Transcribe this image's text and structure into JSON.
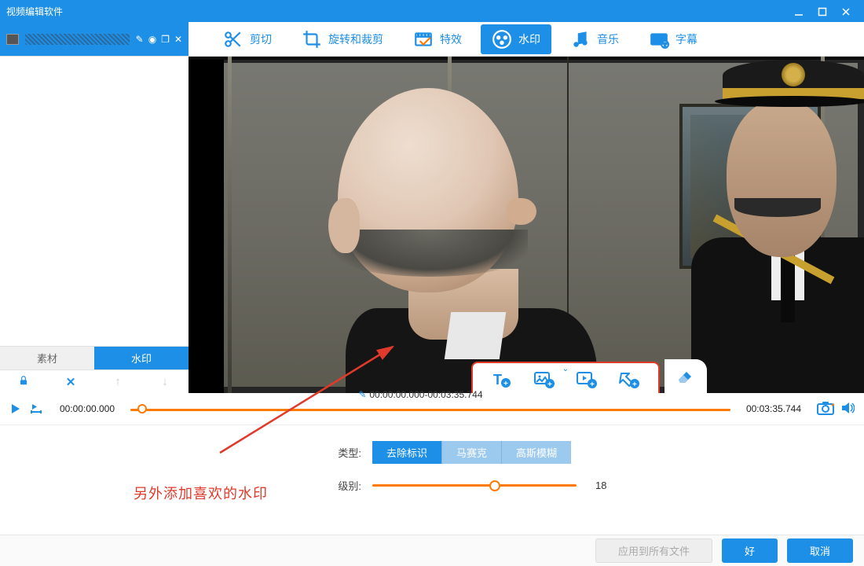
{
  "title": "视频编辑软件",
  "tabs": {
    "cut": "剪切",
    "rotate": "旋转和裁剪",
    "effects": "特效",
    "watermark": "水印",
    "music": "音乐",
    "subtitle": "字幕"
  },
  "sidebar": {
    "tab_material": "素材",
    "tab_watermark": "水印"
  },
  "timeline": {
    "start": "00:00:00.000",
    "range": "00:00:00.000-00:03:35.744",
    "end": "00:03:35.744"
  },
  "settings": {
    "type_label": "类型:",
    "seg": {
      "remove": "去除标识",
      "mosaic": "马赛克",
      "blur": "高斯模糊"
    },
    "level_label": "级别:",
    "level_value": "18",
    "level_percent": 60
  },
  "annotation": "另外添加喜欢的水印",
  "footer": {
    "apply_all": "应用到所有文件",
    "ok": "好",
    "cancel": "取消"
  }
}
